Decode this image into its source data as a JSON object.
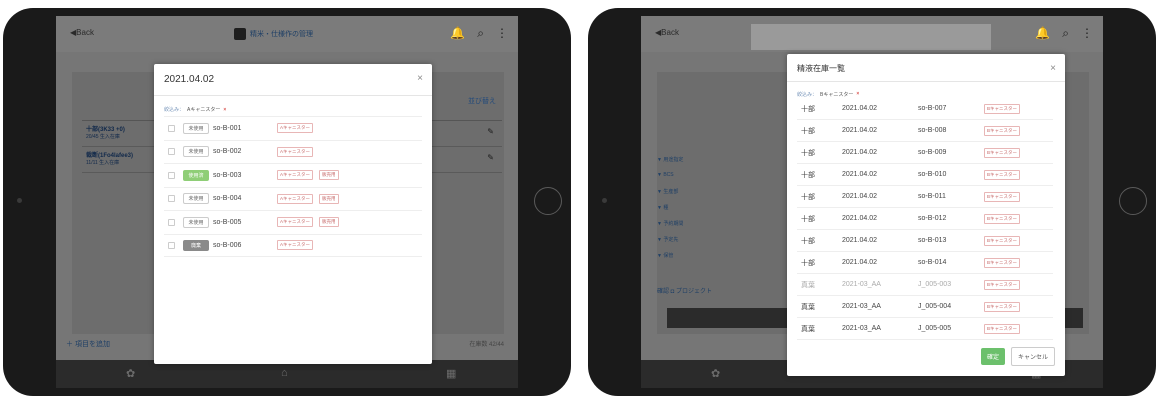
{
  "left": {
    "back": "◀Back",
    "app_title": "精米・仕様作の管理",
    "link": "並び替え",
    "bg_rows": [
      {
        "l1": "十部(3K33 +0)",
        "l2": "20/45 生入在庫"
      },
      {
        "l1": "裁断(1Fo4lafee3)",
        "l2": "11/11 生入在庫"
      }
    ],
    "add_link": "＋ 項目を追加",
    "count": "在庫数 42/44",
    "modal": {
      "title": "2021.04.02",
      "close": "×",
      "filter_label": "絞込み：",
      "filter_value": "Aキャニスター",
      "filter_remove": "×",
      "rows": [
        {
          "status": "未使用",
          "status_type": "plain",
          "code": "so-B-001",
          "tag": "Aキャニスター",
          "tag2": ""
        },
        {
          "status": "未使用",
          "status_type": "plain",
          "code": "so-B-002",
          "tag": "Aキャニスター",
          "tag2": ""
        },
        {
          "status": "使用済",
          "status_type": "green",
          "code": "so-B-003",
          "tag": "Aキャニスター",
          "tag2": "販売用"
        },
        {
          "status": "未使用",
          "status_type": "plain",
          "code": "so-B-004",
          "tag": "Aキャニスター",
          "tag2": "販売用"
        },
        {
          "status": "未使用",
          "status_type": "plain",
          "code": "so-B-005",
          "tag": "Aキャニスター",
          "tag2": "販売用"
        },
        {
          "status": "廃棄",
          "status_type": "gray",
          "code": "so-B-006",
          "tag": "Aキャニスター",
          "tag2": ""
        }
      ]
    }
  },
  "right": {
    "back": "◀Back",
    "side_items": [
      "▼ 用途指定",
      "▼ BCS",
      "▼ 生産部",
      "▼ 種",
      "▼ 予約期間",
      "▼ 予定先",
      "▼ 保管"
    ],
    "bottom_label": "確認  ◘ プロジェクト",
    "modal": {
      "title": "精液在庫一覧",
      "close": "×",
      "filter_label": "絞込み：",
      "filter_value": "Bキャニスター",
      "filter_remove": "×",
      "rows": [
        {
          "kind": "十部",
          "date": "2021.04.02",
          "code": "so-B-007",
          "tag": "Bキャニスター",
          "dim": false
        },
        {
          "kind": "十部",
          "date": "2021.04.02",
          "code": "so-B-008",
          "tag": "Bキャニスター",
          "dim": false
        },
        {
          "kind": "十部",
          "date": "2021.04.02",
          "code": "so-B-009",
          "tag": "Bキャニスター",
          "dim": false
        },
        {
          "kind": "十部",
          "date": "2021.04.02",
          "code": "so-B-010",
          "tag": "Bキャニスター",
          "dim": false
        },
        {
          "kind": "十部",
          "date": "2021.04.02",
          "code": "so-B-011",
          "tag": "Bキャニスター",
          "dim": false
        },
        {
          "kind": "十部",
          "date": "2021.04.02",
          "code": "so-B-012",
          "tag": "Bキャニスター",
          "dim": false
        },
        {
          "kind": "十部",
          "date": "2021.04.02",
          "code": "so-B-013",
          "tag": "Bキャニスター",
          "dim": false
        },
        {
          "kind": "十部",
          "date": "2021.04.02",
          "code": "so-B-014",
          "tag": "Bキャニスター",
          "dim": false
        },
        {
          "kind": "真葉",
          "date": "2021-03_AA",
          "code": "J_005-003",
          "tag": "Bキャニスター",
          "dim": true
        },
        {
          "kind": "真葉",
          "date": "2021-03_AA",
          "code": "J_005-004",
          "tag": "Bキャニスター",
          "dim": false
        },
        {
          "kind": "真葉",
          "date": "2021-03_AA",
          "code": "J_005-005",
          "tag": "Bキャニスター",
          "dim": false
        }
      ],
      "ok": "確定",
      "cancel": "キャンセル"
    }
  },
  "icons": {
    "bell": "bell-icon",
    "search": "search-icon",
    "menu": "more-vert-icon",
    "settings": "gear-icon",
    "home": "home-icon",
    "calendar": "calendar-icon"
  }
}
